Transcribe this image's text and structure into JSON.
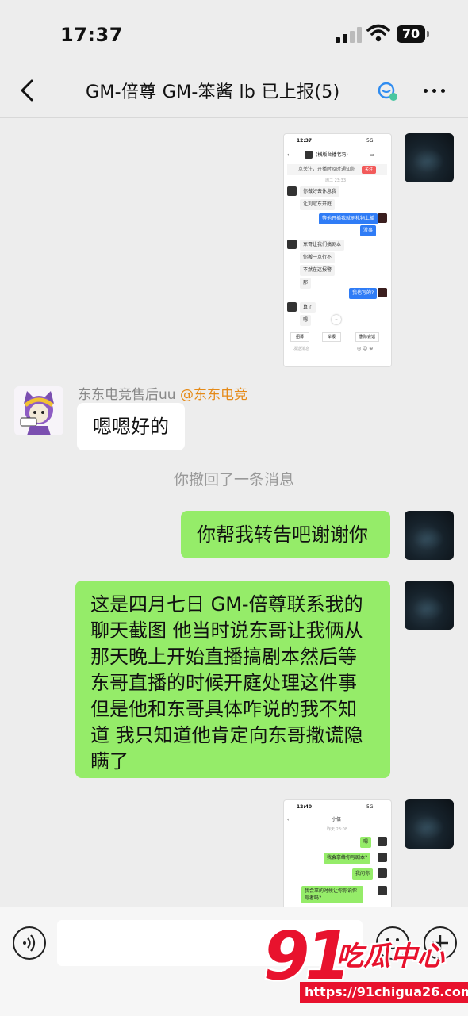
{
  "status_bar": {
    "time": "17:37",
    "battery": "70"
  },
  "header": {
    "title": "GM-倍尊 GM-笨酱 lb 已上报(5)"
  },
  "screenshot1": {
    "time": "12:37",
    "net": "5G",
    "contact": "(横版台播老冯)",
    "notice": "点关注，开播时及时通知你",
    "notice_btn": "关注",
    "date": "周二 23:33",
    "msgs": [
      "你做好去休息我",
      "让刘冠东开庭",
      "等他开播我就刷礼物上播",
      "没事",
      "东哥让我们搞剧本",
      "你搬一点行不",
      "不然在这报警",
      "那",
      "我也写的?",
      "算了",
      "嗯"
    ],
    "actions": [
      "招募",
      "举报",
      "删除会话"
    ],
    "input_placeholder": "发送消息"
  },
  "msg_ok": {
    "sender": "东东电竞售后uu",
    "tag": "@东东电竞",
    "text": "嗯嗯好的"
  },
  "system_notice": "你撤回了一条消息",
  "msg_forward": "你帮我转告吧谢谢你",
  "msg_long": [
    "这是四月七日 GM-倍尊联系我的",
    "聊天截图 他当时说东哥让我俩从",
    "那天晚上开始直播搞剧本然后等",
    "东哥直播的时候开庭处理这件事",
    "但是他和东哥具体咋说的我不知",
    "道 我只知道他肯定向东哥撒谎隐",
    "瞒了"
  ],
  "screenshot2": {
    "time": "12:40",
    "net": "5G",
    "contact": "小倍",
    "date": "昨天 23:08",
    "msgs": [
      "嗯",
      "我会拿给你写剧本?",
      "我问你",
      "我会拿的时候让你你说你写者吗?"
    ]
  },
  "watermark": {
    "logo_num": "91",
    "logo_text": "吃瓜中心",
    "url": "https://91chigua26.com"
  },
  "colors": {
    "bubble_green": "#95ec69",
    "bg": "#ededed",
    "watermark_red": "#e8122d"
  }
}
